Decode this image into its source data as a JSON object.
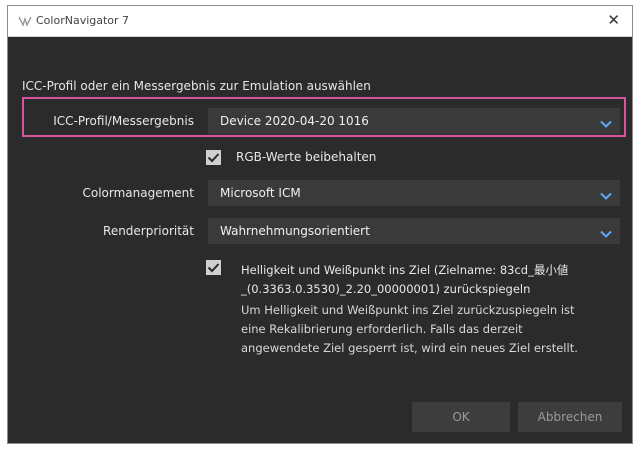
{
  "window": {
    "title": "ColorNavigator 7",
    "app_icon": "colornavigator-icon",
    "close_glyph": "✕"
  },
  "heading": "ICC-Profil oder ein Messergebnis zur Emulation auswählen",
  "profile": {
    "label": "ICC-Profil/Messergebnis",
    "value": "Device 2020-04-20 1016"
  },
  "keep_rgb": {
    "checked": true,
    "label": "RGB-Werte beibehalten"
  },
  "color_management": {
    "label": "Colormanagement",
    "value": "Microsoft ICM"
  },
  "render_priority": {
    "label": "Renderpriorität",
    "value": "Wahrnehmungsorientiert"
  },
  "brightness": {
    "checked": true,
    "label_line1": "Helligkeit und Weißpunkt ins Ziel (Zielname: 83cd_最小値",
    "label_line2": "_(0.3363.0.3530)_2.20_00000001) zurückspiegeln",
    "desc_line1": "Um Helligkeit und Weißpunkt ins Ziel zurückzuspiegeln ist",
    "desc_line2": "eine Rekalibrierung erforderlich. Falls das derzeit",
    "desc_line3": "angewendete Ziel gesperrt ist, wird ein neues Ziel erstellt."
  },
  "buttons": {
    "ok": "OK",
    "cancel": "Abbrechen"
  },
  "colors": {
    "background": "#2b2b2b",
    "highlight": "#d4569a",
    "chevron": "#5aa9ff"
  }
}
